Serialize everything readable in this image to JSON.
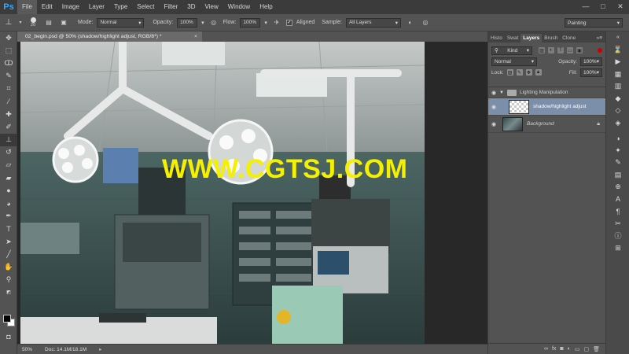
{
  "app": {
    "logo": "Ps"
  },
  "menu": [
    "File",
    "Edit",
    "Image",
    "Layer",
    "Type",
    "Select",
    "Filter",
    "3D",
    "View",
    "Window",
    "Help"
  ],
  "window_controls": [
    "—",
    "□",
    "✕"
  ],
  "options": {
    "brush_size": "20",
    "mode_label": "Mode:",
    "mode_value": "Normal",
    "opacity_label": "Opacity:",
    "opacity_value": "100%",
    "flow_label": "Flow:",
    "flow_value": "100%",
    "aligned_label": "Aligned",
    "sample_label": "Sample:",
    "sample_value": "All Layers",
    "workspace": "Painting"
  },
  "document": {
    "tab_title": "02_begin.psd @ 50% (shadow/highlight adjust, RGB/8*) *",
    "watermark": "WWW.CGTSJ.COM",
    "zoom": "50%",
    "doc_info": "Doc: 14.1M/18.1M"
  },
  "panel": {
    "tabs": [
      "Histo",
      "Swat",
      "Layers",
      "Brush",
      "Clone"
    ],
    "active_tab": "Layers",
    "filter_kind": "Kind",
    "blend_mode": "Normal",
    "opacity_label": "Opacity:",
    "opacity_value": "100%",
    "lock_label": "Lock:",
    "fill_label": "Fill:",
    "fill_value": "100%",
    "layers": [
      {
        "name": "Lighting Manipulation",
        "type": "group"
      },
      {
        "name": "shadow/highlight adjust",
        "type": "layer",
        "selected": true
      },
      {
        "name": "Background",
        "type": "background"
      }
    ],
    "footer_icons": [
      "link",
      "fx",
      "mask",
      "adjust",
      "folder",
      "new",
      "trash"
    ]
  },
  "colors": {
    "accent": "#31a8ff",
    "watermark": "#f4f000",
    "selection": "#7b8eaa"
  }
}
